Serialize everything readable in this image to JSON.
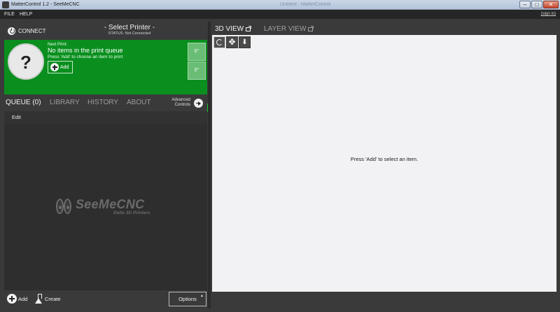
{
  "window": {
    "title": "MatterControl 1.2 - SeeMeCNC",
    "background_title": "Untitled - MatterControl",
    "controls": {
      "minimize": "–",
      "maximize": "□",
      "close": "✕"
    }
  },
  "menubar": {
    "items": [
      "FILE",
      "HELP"
    ],
    "sign_in": "(sign in)"
  },
  "printer": {
    "connect_label": "CONNECT",
    "name": "- Select Printer -",
    "status": "STATUS: Not Connected"
  },
  "next_print": {
    "placeholder_glyph": "?",
    "caption": "Next Print:",
    "title": "No items in the print queue",
    "hint": "Press 'Add' to choose an item to print",
    "add_label": "Add",
    "temps": [
      "0°",
      "0°"
    ],
    "progress_fraction": 1.0
  },
  "tabs": {
    "items": [
      "QUEUE (0)",
      "LIBRARY",
      "HISTORY",
      "ABOUT"
    ],
    "active": "QUEUE (0)",
    "advanced_line1": "Advanced",
    "advanced_line2": "Controls"
  },
  "queue": {
    "edit_label": "Edit",
    "logo_brand": "SeeMeCNC",
    "logo_sub": "Delta 3D Printers"
  },
  "queue_footer": {
    "add_label": "Add",
    "create_label": "Create",
    "options_label": "Options",
    "options_caret": "▲"
  },
  "view_tabs": {
    "items": [
      "3D VIEW",
      "LAYER VIEW"
    ],
    "active": "3D VIEW"
  },
  "viewport": {
    "tools": [
      "rotate",
      "move",
      "scale"
    ],
    "move_glyph": "✥",
    "scale_glyph": "⬇",
    "hint": "Press 'Add' to select an item."
  },
  "colors": {
    "accent_green": "#0a8f1f",
    "progress_green": "#18c431",
    "panel_bg": "#3a3a3a",
    "viewport_bg": "#f2f2f4"
  }
}
